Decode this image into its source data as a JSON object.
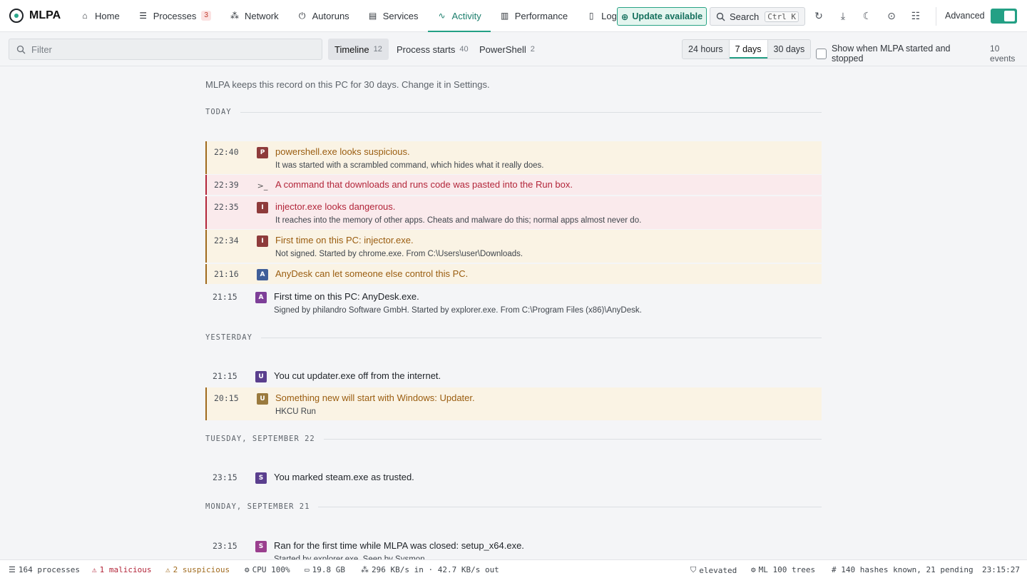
{
  "app": {
    "name": "MLPA"
  },
  "nav": [
    {
      "label": "Home",
      "icon": "home-icon",
      "glyph": "⌂"
    },
    {
      "label": "Processes",
      "icon": "list-icon",
      "glyph": "☰",
      "badge": "3"
    },
    {
      "label": "Network",
      "icon": "network-icon",
      "glyph": "⁂"
    },
    {
      "label": "Autoruns",
      "icon": "power-icon",
      "glyph": "⏻"
    },
    {
      "label": "Services",
      "icon": "server-icon",
      "glyph": "▤"
    },
    {
      "label": "Activity",
      "icon": "activity-icon",
      "glyph": "∿",
      "active": true
    },
    {
      "label": "Performance",
      "icon": "bar-chart-icon",
      "glyph": "▥"
    },
    {
      "label": "Log",
      "icon": "file-icon",
      "glyph": "▯"
    }
  ],
  "toolbar": {
    "update_label": "Update available",
    "search_label": "Search",
    "search_shortcut": "Ctrl K",
    "advanced_label": "Advanced"
  },
  "filter": {
    "placeholder": "Filter"
  },
  "subtabs": [
    {
      "label": "Timeline",
      "count": "12",
      "active": true
    },
    {
      "label": "Process starts",
      "count": "40"
    },
    {
      "label": "PowerShell",
      "count": "2"
    }
  ],
  "ranges": [
    {
      "label": "24 hours"
    },
    {
      "label": "7 days",
      "active": true
    },
    {
      "label": "30 days"
    }
  ],
  "show_toggle": {
    "label": "Show when MLPA started and stopped",
    "count": "10 events"
  },
  "retention_note": "MLPA keeps this record on this PC for 30 days. Change it in Settings.",
  "days": [
    {
      "label": "TODAY",
      "events": [
        {
          "time": "22:40",
          "level": "warn",
          "icon_letter": "P",
          "icon_color": "#8e3b3b",
          "title": "powershell.exe looks suspicious.",
          "detail": "It was started with a scrambled command, which hides what it really does."
        },
        {
          "time": "22:39",
          "level": "danger",
          "icon_letter": ">_",
          "icon_color": "",
          "title": "A command that downloads and runs code was pasted into the Run box.",
          "detail": ""
        },
        {
          "time": "22:35",
          "level": "danger",
          "icon_letter": "I",
          "icon_color": "#8e3b3b",
          "title": "injector.exe looks dangerous.",
          "detail": "It reaches into the memory of other apps. Cheats and malware do this; normal apps almost never do."
        },
        {
          "time": "22:34",
          "level": "warn",
          "icon_letter": "I",
          "icon_color": "#8e3b3b",
          "title": "First time on this PC: injector.exe.",
          "detail": "Not signed. Started by chrome.exe. From C:\\Users\\user\\Downloads."
        },
        {
          "time": "21:16",
          "level": "warn",
          "icon_letter": "A",
          "icon_color": "#3f5e99",
          "title": "AnyDesk can let someone else control this PC.",
          "detail": ""
        },
        {
          "time": "21:15",
          "level": "normal",
          "icon_letter": "A",
          "icon_color": "#7d3f98",
          "title": "First time on this PC: AnyDesk.exe.",
          "detail": "Signed by philandro Software GmbH. Started by explorer.exe. From C:\\Program Files (x86)\\AnyDesk."
        }
      ]
    },
    {
      "label": "YESTERDAY",
      "events": [
        {
          "time": "21:15",
          "level": "normal",
          "icon_letter": "U",
          "icon_color": "#5a3f8e",
          "title": "You cut updater.exe off from the internet.",
          "detail": ""
        },
        {
          "time": "20:15",
          "level": "warn",
          "icon_letter": "U",
          "icon_color": "#9a7a3e",
          "title": "Something new will start with Windows: Updater.",
          "detail": "HKCU Run"
        }
      ]
    },
    {
      "label": "TUESDAY, SEPTEMBER 22",
      "events": [
        {
          "time": "23:15",
          "level": "normal",
          "icon_letter": "S",
          "icon_color": "#5a3f8e",
          "title": "You marked steam.exe as trusted.",
          "detail": ""
        }
      ]
    },
    {
      "label": "MONDAY, SEPTEMBER 21",
      "events": [
        {
          "time": "23:15",
          "level": "normal",
          "icon_letter": "S",
          "icon_color": "#9a3f8e",
          "title": "Ran for the first time while MLPA was closed: setup_x64.exe.",
          "detail": "Started by explorer.exe. Seen by Sysmon."
        }
      ]
    }
  ],
  "status": {
    "processes": "164 processes",
    "malicious": "1 malicious",
    "suspicious": "2 suspicious",
    "cpu": "CPU 100%",
    "memory": "19.8 GB",
    "network": "296 KB/s in · 42.7 KB/s out",
    "elevation": "elevated",
    "ml": "ML 100 trees",
    "hashes": "# 140 hashes known, 21 pending",
    "clock": "23:15:27"
  },
  "colors": {
    "accent": "#24a085",
    "warn": "#a06a1d",
    "danger": "#b3263a"
  }
}
